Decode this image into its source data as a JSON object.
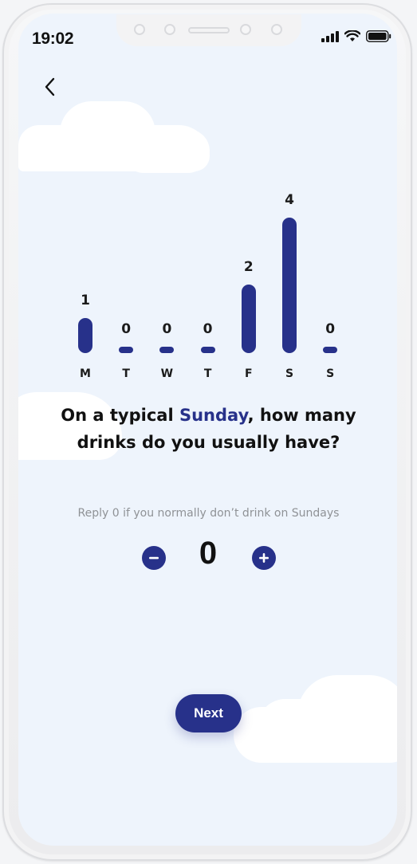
{
  "status_bar": {
    "time": "19:02"
  },
  "chart_data": {
    "type": "bar",
    "categories": [
      "M",
      "T",
      "W",
      "T",
      "F",
      "S",
      "S"
    ],
    "values": [
      1,
      0,
      0,
      0,
      2,
      4,
      0
    ],
    "bar_color": "#27318a"
  },
  "question": {
    "prefix": "On a typical ",
    "highlight": "Sunday",
    "suffix": ", how many drinks do you usually have?"
  },
  "hint": "Reply 0 if you normally don’t drink on Sundays",
  "stepper": {
    "value": "0",
    "decrement_icon": "minus-icon",
    "increment_icon": "plus-icon"
  },
  "next_label": "Next",
  "colors": {
    "accent": "#27318a",
    "background": "#eef4fc"
  }
}
